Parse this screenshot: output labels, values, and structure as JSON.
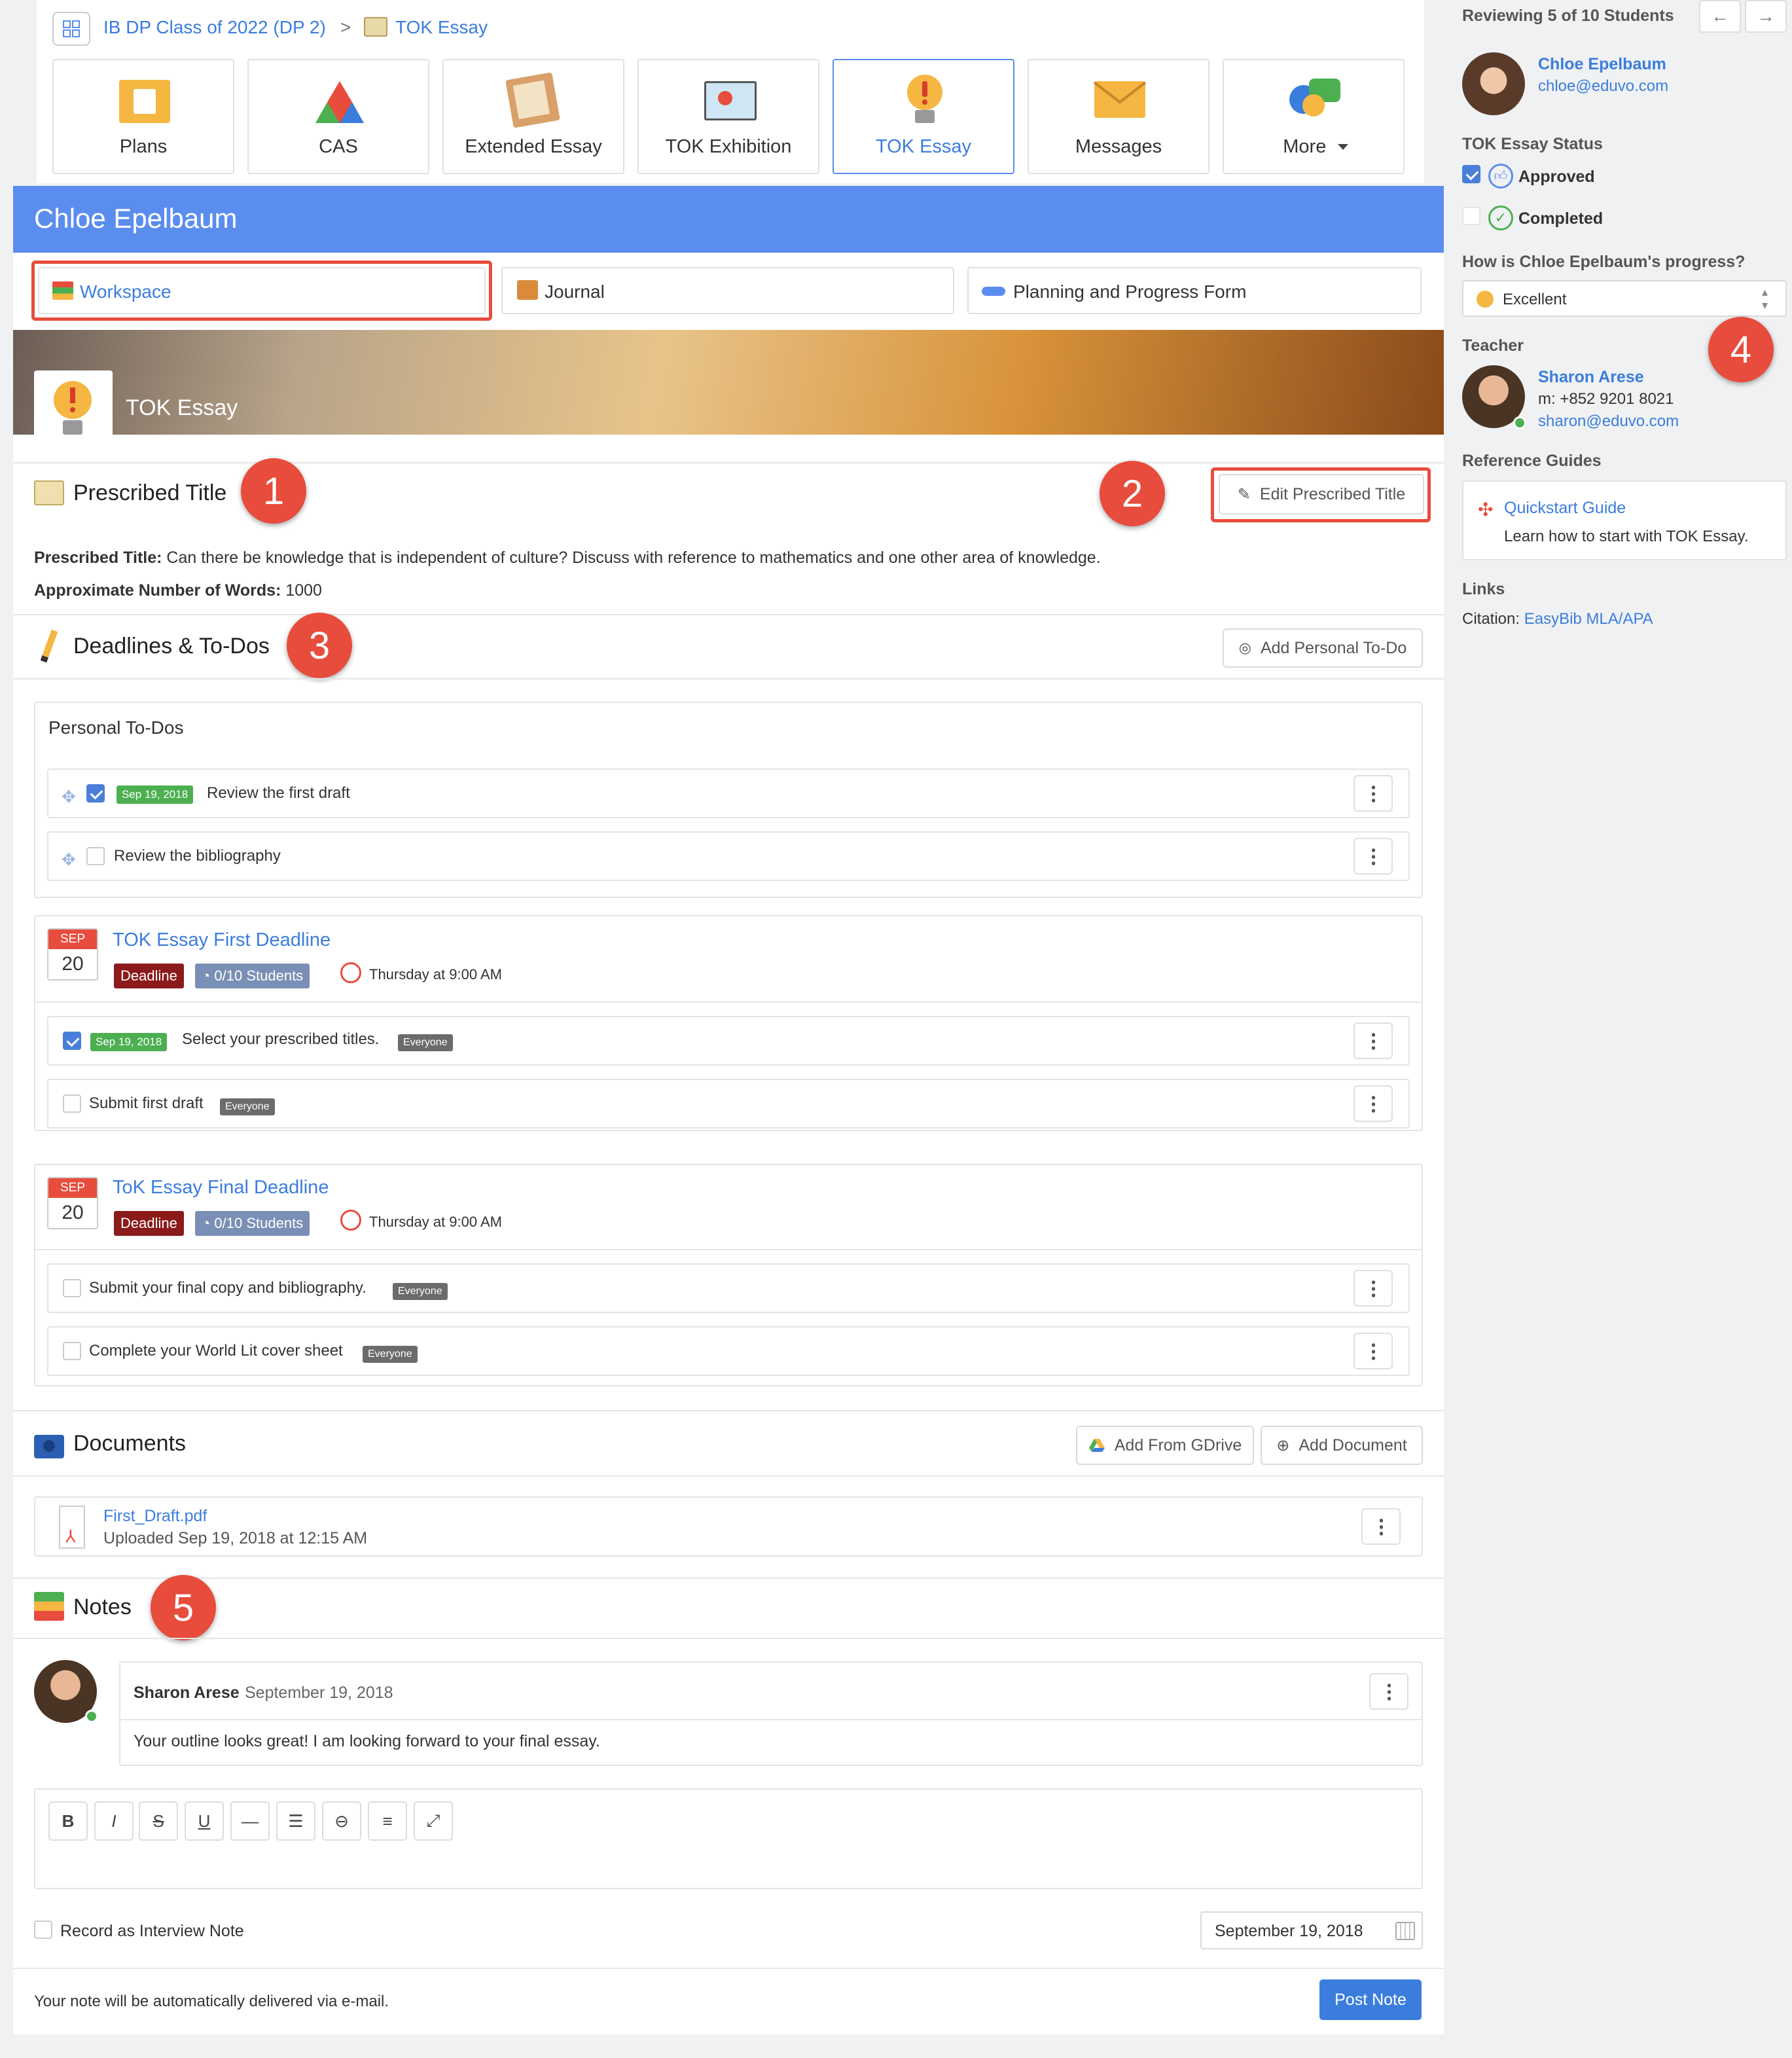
{
  "breadcrumb": {
    "class": "IB DP Class of 2022 (DP 2)",
    "separator": ">",
    "current": "TOK Essay"
  },
  "tabs": [
    {
      "label": "Plans",
      "icon": "plans-icon"
    },
    {
      "label": "CAS",
      "icon": "cas-icon"
    },
    {
      "label": "Extended Essay",
      "icon": "extended-essay-icon"
    },
    {
      "label": "TOK Exhibition",
      "icon": "tok-exhibition-icon"
    },
    {
      "label": "TOK Essay",
      "icon": "lightbulb-icon",
      "active": true
    },
    {
      "label": "Messages",
      "icon": "envelope-icon"
    },
    {
      "label": "More",
      "icon": "more-icon"
    }
  ],
  "student": {
    "name": "Chloe Epelbaum"
  },
  "subtabs": {
    "workspace": "Workspace",
    "journal": "Journal",
    "planning": "Planning and Progress Form"
  },
  "banner": {
    "title": "TOK Essay"
  },
  "prescribed": {
    "heading": "Prescribed Title",
    "edit_button": "Edit Prescribed Title",
    "title_label": "Prescribed Title:",
    "title_value": "Can there be knowledge that is independent of culture? Discuss with reference to mathematics and one other area of knowledge.",
    "words_label": "Approximate Number of Words:",
    "words_value": "1000"
  },
  "deadlines": {
    "heading": "Deadlines & To-Dos",
    "add_button": "Add Personal To-Do",
    "personal": {
      "heading": "Personal To-Dos",
      "items": [
        {
          "date": "Sep 19, 2018",
          "text": "Review the first draft",
          "checked": true
        },
        {
          "date": "",
          "text": "Review the bibliography",
          "checked": false
        }
      ]
    },
    "groups": [
      {
        "month": "SEP",
        "day": "20",
        "title": "TOK Essay First Deadline",
        "tag": "Deadline",
        "students": "0/10 Students",
        "time": "Thursday at 9:00 AM",
        "items": [
          {
            "date": "Sep 19, 2018",
            "text": "Select your prescribed titles.",
            "badge": "Everyone",
            "checked": true
          },
          {
            "date": "",
            "text": "Submit first draft",
            "badge": "Everyone",
            "checked": false
          }
        ]
      },
      {
        "month": "SEP",
        "day": "20",
        "title": "ToK Essay Final Deadline",
        "tag": "Deadline",
        "students": "0/10 Students",
        "time": "Thursday at 9:00 AM",
        "items": [
          {
            "date": "",
            "text": "Submit your final copy and bibliography.",
            "badge": "Everyone",
            "checked": false
          },
          {
            "date": "",
            "text": "Complete your World Lit cover sheet",
            "badge": "Everyone",
            "checked": false
          }
        ]
      }
    ]
  },
  "documents": {
    "heading": "Documents",
    "gdrive_button": "Add From GDrive",
    "add_button": "Add Document",
    "file": {
      "name": "First_Draft.pdf",
      "uploaded": "Uploaded Sep 19, 2018 at 12:15 AM"
    }
  },
  "notes": {
    "heading": "Notes",
    "author": "Sharon Arese",
    "date": "September 19, 2018",
    "body": "Your outline looks great! I am looking forward to your final essay.",
    "toolbar": [
      "B",
      "I",
      "S",
      "U",
      "—",
      "list",
      "link",
      "align",
      "expand"
    ],
    "interview_label": "Record as Interview Note",
    "date_value": "September 19, 2018",
    "footer_text": "Your note will be automatically delivered via e-mail.",
    "post_button": "Post Note"
  },
  "sidebar": {
    "reviewing": "Reviewing 5 of 10 Students",
    "student_name": "Chloe Epelbaum",
    "student_email": "chloe@eduvo.com",
    "status_label": "TOK Essay Status",
    "approved": "Approved",
    "completed": "Completed",
    "progress_question": "How is Chloe Epelbaum's progress?",
    "progress_value": "Excellent",
    "teacher_label": "Teacher",
    "teacher_name": "Sharon Arese",
    "teacher_phone": "m: +852 9201 8021",
    "teacher_email": "sharon@eduvo.com",
    "guides_label": "Reference Guides",
    "guide_title": "Quickstart Guide",
    "guide_desc": "Learn how to start with TOK Essay.",
    "links_label": "Links",
    "citation_label": "Citation:",
    "citation_link": "EasyBib MLA/APA"
  },
  "callouts": [
    "1",
    "2",
    "3",
    "4",
    "5"
  ],
  "colors": {
    "accent": "#5b8def",
    "link": "#3b7ddd",
    "callout": "#e74c3c",
    "deadline": "#8b1a1a",
    "students_badge": "#7a8fb5",
    "date_badge": "#4caf50"
  }
}
